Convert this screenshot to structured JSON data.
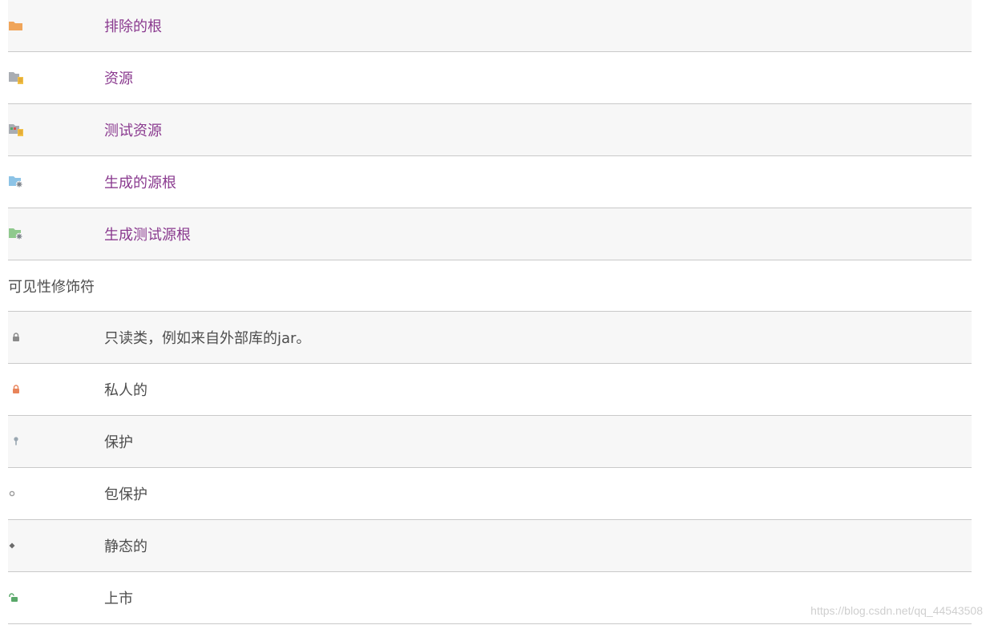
{
  "folder_rows": [
    {
      "label": "排除的根",
      "icon": "excluded-root-folder-icon"
    },
    {
      "label": "资源",
      "icon": "resources-folder-icon"
    },
    {
      "label": "测试资源",
      "icon": "test-resources-folder-icon"
    },
    {
      "label": "生成的源根",
      "icon": "generated-source-root-icon"
    },
    {
      "label": "生成测试源根",
      "icon": "generated-test-source-root-icon"
    }
  ],
  "section": {
    "title": "可见性修饰符"
  },
  "modifier_rows": [
    {
      "label": "只读类，例如来自外部库的jar。",
      "icon": "read-only-lock-icon"
    },
    {
      "label": "私人的",
      "icon": "private-lock-icon"
    },
    {
      "label": "保护",
      "icon": "protected-key-icon"
    },
    {
      "label": "包保护",
      "icon": "package-private-circle-icon"
    },
    {
      "label": "静态的",
      "icon": "static-diamond-icon"
    },
    {
      "label": "上市",
      "icon": "public-unlock-icon"
    }
  ],
  "watermark": "https://blog.csdn.net/qq_44543508",
  "colors": {
    "link": "#8a3a8f",
    "text": "#4d4d4d",
    "row_alt": "#f7f7f7",
    "border": "#c9c9c9"
  }
}
